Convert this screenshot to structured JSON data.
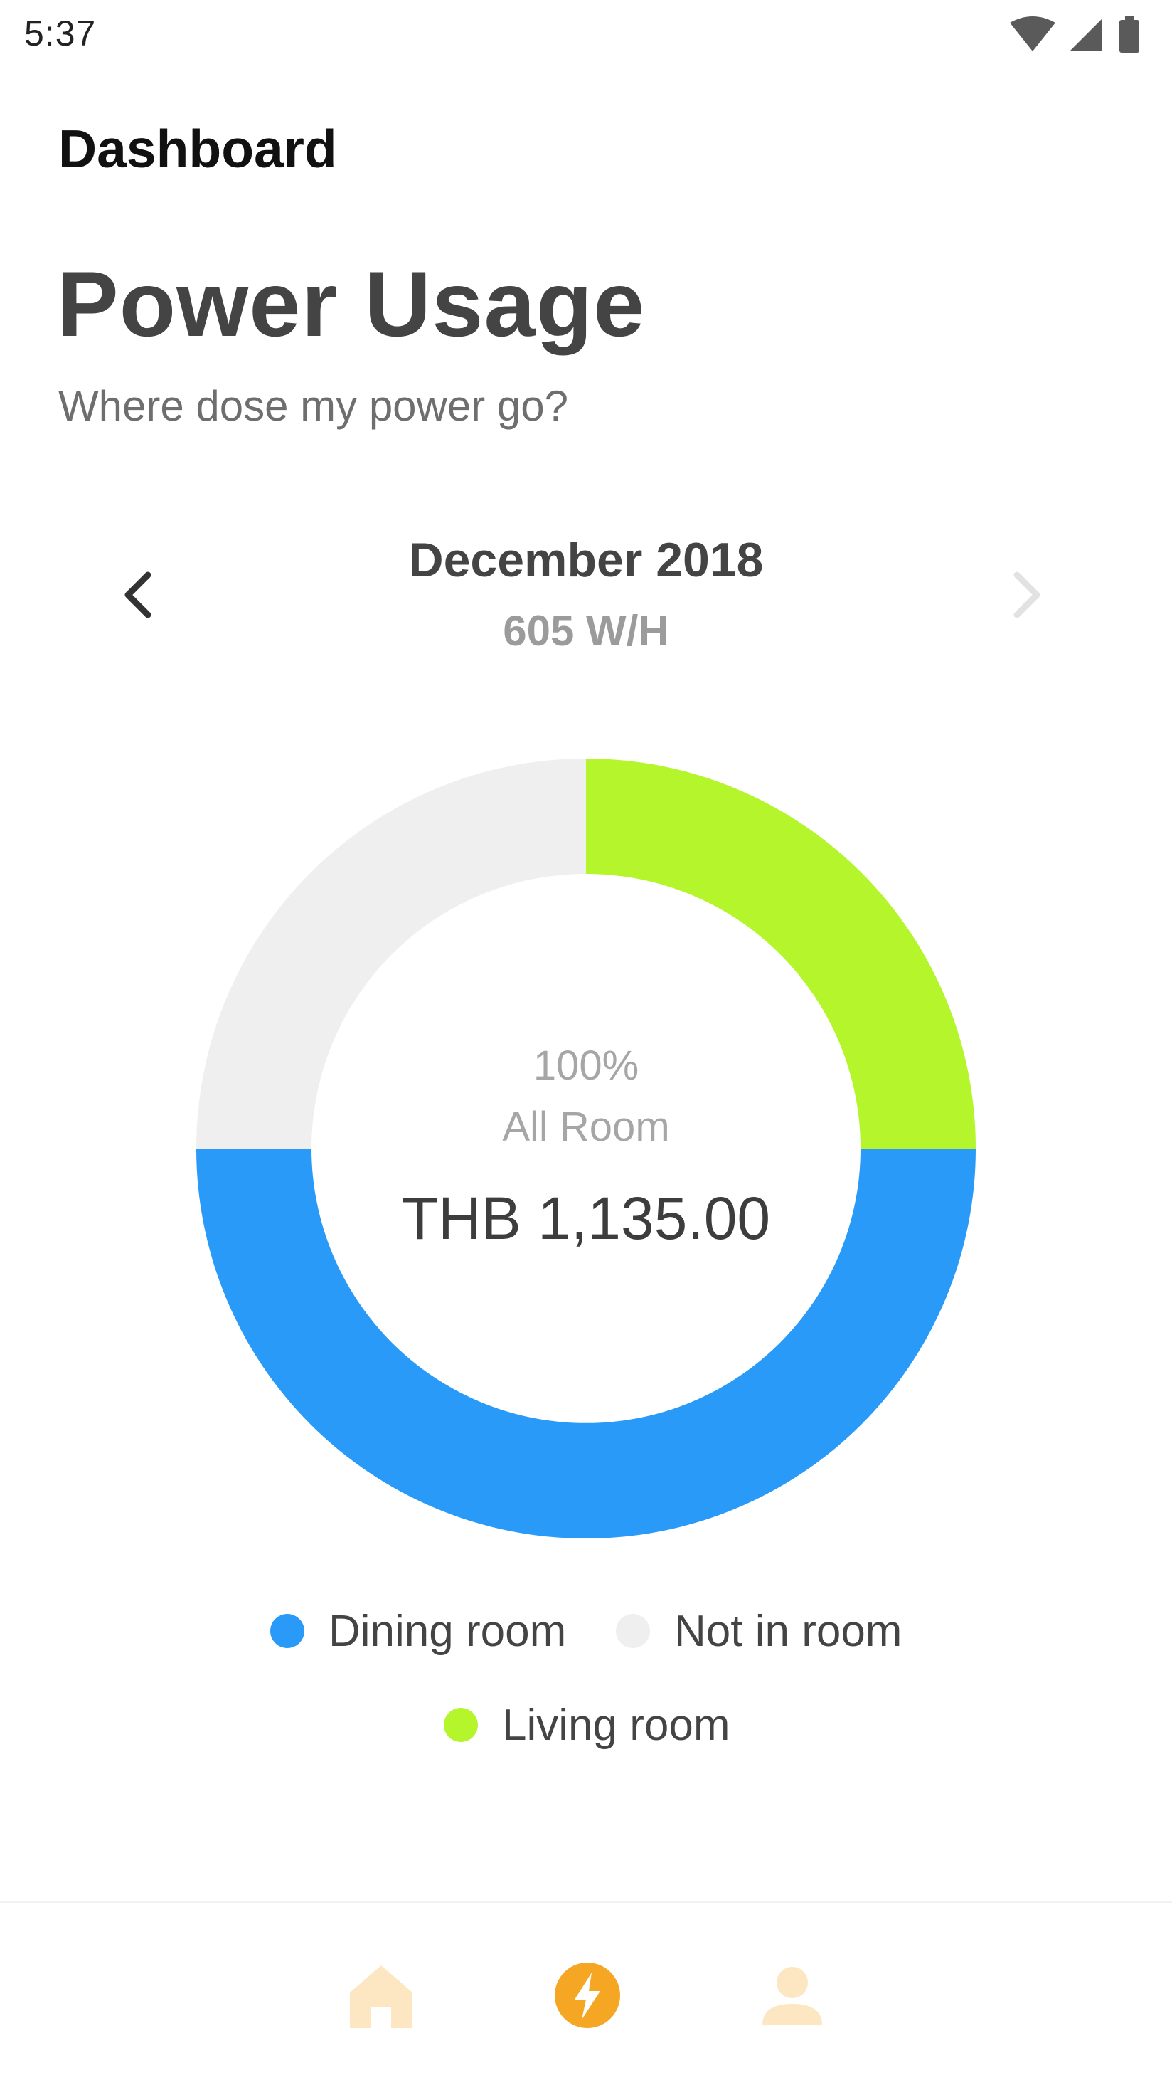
{
  "status_bar": {
    "time": "5:37",
    "icons": [
      "wifi-icon",
      "cell-signal-icon",
      "battery-icon"
    ]
  },
  "header": {
    "app_title": "Dashboard"
  },
  "page": {
    "title": "Power Usage",
    "subtitle": "Where dose my power go?"
  },
  "period": {
    "label": "December 2018",
    "usage": "605 W/H",
    "prev_icon": "chevron-left-icon",
    "next_icon": "chevron-right-icon"
  },
  "chart_data": {
    "type": "pie",
    "variant": "donut",
    "center": {
      "percent": "100%",
      "label": "All Room",
      "amount": "THB 1,135.00"
    },
    "slices": [
      {
        "name": "Living room",
        "value": 25,
        "color": "#b5f52b"
      },
      {
        "name": "Dining room",
        "value": 50,
        "color": "#2a9af8"
      },
      {
        "name": "Not in room",
        "value": 25,
        "color": "#efefef"
      }
    ],
    "legend": [
      {
        "name": "Dining room",
        "color": "#2a9af8"
      },
      {
        "name": "Not in room",
        "color": "#efefef"
      },
      {
        "name": "Living room",
        "color": "#b5f52b"
      }
    ],
    "legend_placement": "bottom"
  },
  "bottom_nav": {
    "items": [
      {
        "name": "home",
        "icon": "home-icon",
        "active": false
      },
      {
        "name": "power",
        "icon": "lightning-icon",
        "active": true
      },
      {
        "name": "profile",
        "icon": "user-icon",
        "active": false
      }
    ],
    "active_color": "#f5a623",
    "inactive_color": "#fde6c2"
  }
}
